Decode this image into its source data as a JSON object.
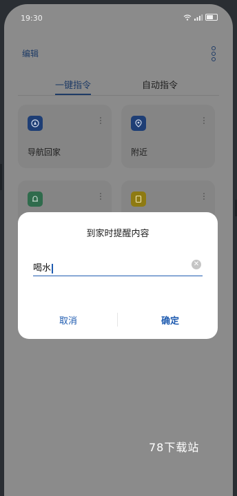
{
  "status_bar": {
    "time": "19:30"
  },
  "header": {
    "edit_label": "编辑"
  },
  "tabs": [
    {
      "label": "一键指令",
      "active": true
    },
    {
      "label": "自动指令",
      "active": false
    }
  ],
  "cards": [
    {
      "label": "导航回家",
      "icon": "compass-icon",
      "color": "#1e3e75"
    },
    {
      "label": "附近",
      "icon": "location-pin-icon",
      "color": "#1e3e75"
    },
    {
      "label": "",
      "icon": "bell-icon",
      "color": "#2f6b4c"
    },
    {
      "label": "",
      "icon": "note-icon",
      "color": "#8e7a12"
    }
  ],
  "dialog": {
    "title": "到家时提醒内容",
    "input_value": "喝水",
    "cancel_label": "取消",
    "confirm_label": "确定"
  },
  "watermark": "78下载站",
  "colors": {
    "accent": "#1e5bb0",
    "dim_overlay": "#8b8b8b"
  }
}
